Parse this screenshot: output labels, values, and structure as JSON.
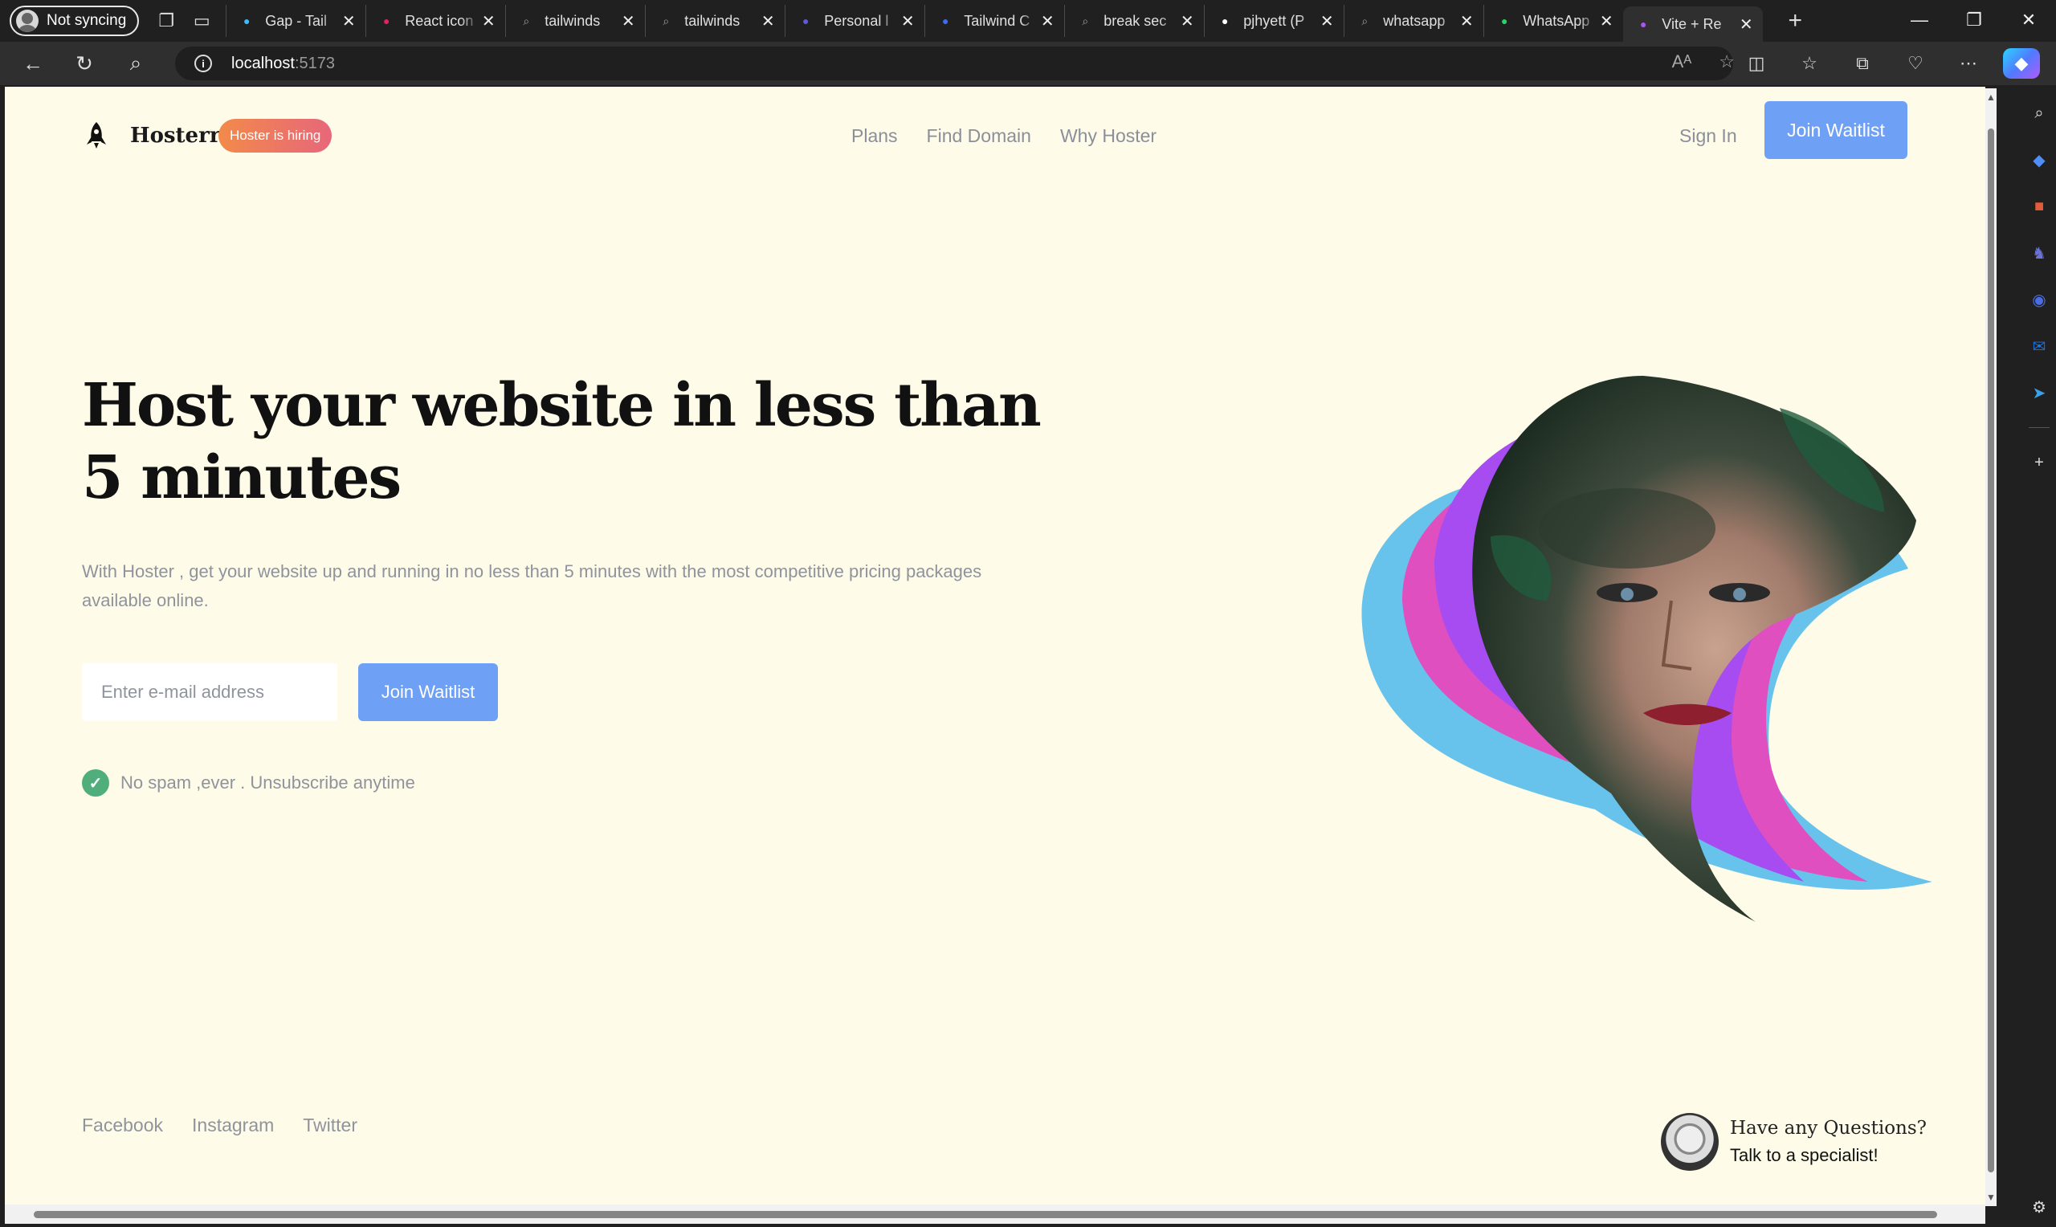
{
  "browser": {
    "profile_label": "Not syncing",
    "tabs": [
      {
        "title": "Gap - Tail",
        "icon": "tailwind-icon",
        "color": "#38bdf8"
      },
      {
        "title": "React icon",
        "icon": "react-icons-icon",
        "color": "#e91e63"
      },
      {
        "title": "tailwinds",
        "icon": "search-icon",
        "color": "#9aa0a6"
      },
      {
        "title": "tailwinds",
        "icon": "search-icon",
        "color": "#9aa0a6"
      },
      {
        "title": "Personal l",
        "icon": "personal-site-icon",
        "color": "#5b5bd6"
      },
      {
        "title": "Tailwind C",
        "icon": "tailwind-components-icon",
        "color": "#3b6cf6"
      },
      {
        "title": "break sec",
        "icon": "search-icon",
        "color": "#9aa0a6"
      },
      {
        "title": "pjhyett (P",
        "icon": "github-icon",
        "color": "#ffffff"
      },
      {
        "title": "whatsapp",
        "icon": "search-icon",
        "color": "#9aa0a6"
      },
      {
        "title": "WhatsApp",
        "icon": "whatsapp-icon",
        "color": "#25d366"
      },
      {
        "title": "Vite + Re",
        "icon": "vite-icon",
        "color": "#a855f7"
      }
    ],
    "url_host": "localhost",
    "url_port": ":5173"
  },
  "page": {
    "brand": "Hosterr",
    "badge": "Hoster is hiring",
    "nav": [
      "Plans",
      "Find Domain",
      "Why Hoster"
    ],
    "sign_in": "Sign In",
    "join_waitlist_top": "Join Waitlist",
    "headline": "Host your website in less than 5 minutes",
    "subtext": "With Hoster , get your website up and running in no less than 5 minutes with the most competitive pricing packages available online.",
    "email_placeholder": "Enter e-mail address",
    "join_waitlist_main": "Join Waitlist",
    "no_spam": "No spam ,ever . Unsubscribe anytime",
    "footer_links": [
      "Facebook",
      "Instagram",
      "Twitter"
    ],
    "contact_question": "Have any Questions?",
    "contact_cta": "Talk to a specialist!"
  },
  "colors": {
    "page_bg": "#fefbe9",
    "button_blue": "#6ea0f5",
    "badge_gradient_start": "#f28a4a",
    "badge_gradient_end": "#e7677a",
    "check_green": "#4fae7b",
    "art_blue": "#67c3ec",
    "art_pink": "#e04fbf",
    "art_purple": "#a64cf0"
  }
}
